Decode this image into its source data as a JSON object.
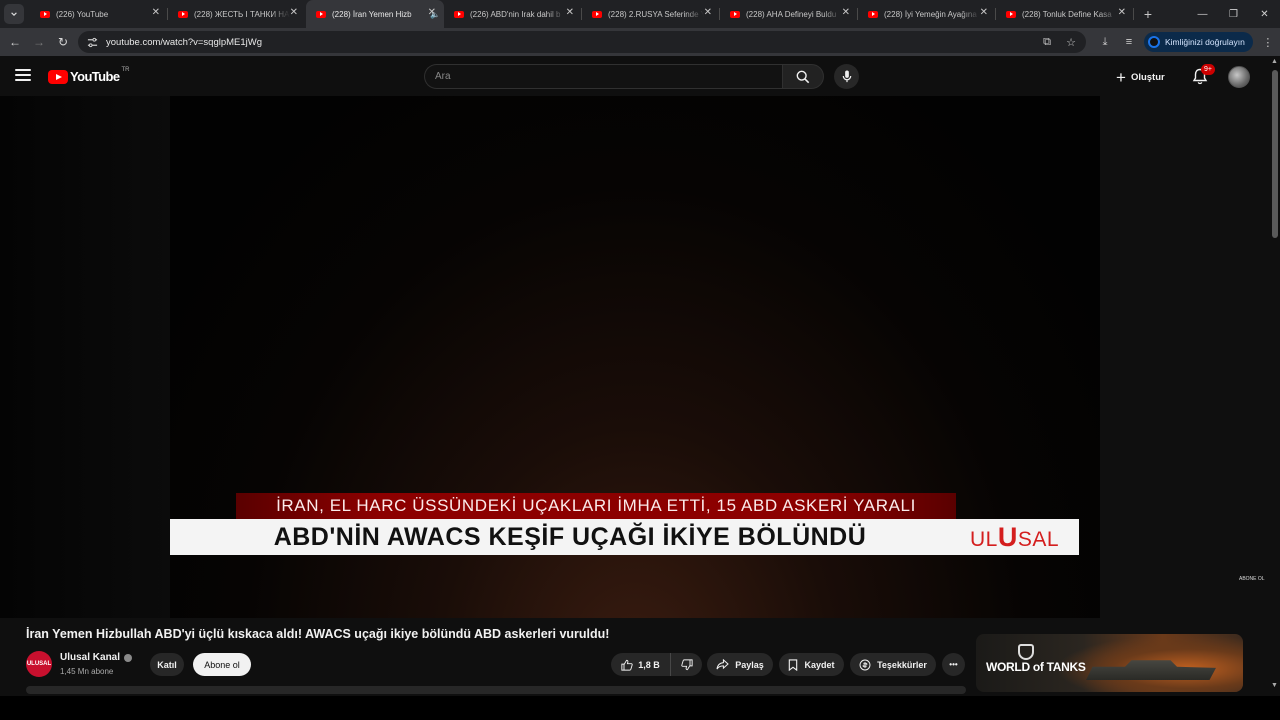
{
  "browser": {
    "tabs": [
      {
        "title": "(226) YouTube",
        "active": false
      },
      {
        "title": "(228) ЖЕСТЬ І ТАНКИ НА",
        "active": false
      },
      {
        "title": "(228) İran Yemen Hizb",
        "active": true
      },
      {
        "title": "(226) ABD'nin Irak dahil b",
        "active": false
      },
      {
        "title": "(228) 2.RUSYA Seferinde Y",
        "active": false
      },
      {
        "title": "(228) AHA Defineyi Buldu",
        "active": false
      },
      {
        "title": "(228) İyi Yemeğin Ayağına",
        "active": false
      },
      {
        "title": "(228) Tonluk Define Kasa",
        "active": false
      }
    ],
    "close_glyph": "✕",
    "newtab_glyph": "+",
    "url": "youtube.com/watch?v=sqglpME1jWg",
    "profile_chip": "Kimliğinizi doğrulayın"
  },
  "youtube": {
    "logo_text": "YouTube",
    "country_code": "TR",
    "search_placeholder": "Ara",
    "create_label": "Oluştur",
    "notifications_badge": "9+"
  },
  "video": {
    "overlay_red": "İRAN, EL HARC ÜSSÜNDEKİ UÇAKLARI İMHA ETTİ, 15 ABD ASKERİ YARALI",
    "overlay_white": "ABD'NİN AWACS KEŞİF UÇAĞI İKİYE BÖLÜNDÜ",
    "brand_left": "UL",
    "brand_mid": "U",
    "brand_right": "SAL",
    "corner_text": "ABONE OL",
    "title": "İran Yemen Hizbullah ABD'yi üçlü kıskaca aldı! AWACS uçağı ikiye bölündü ABD askerleri vuruldu!"
  },
  "channel": {
    "name": "Ulusal Kanal",
    "avatar_text": "ULUSAL",
    "subscribers": "1,45 Mn abone",
    "join_label": "Katıl",
    "subscribe_label": "Abone ol"
  },
  "actions": {
    "like_count": "1,8 B",
    "share_label": "Paylaş",
    "save_label": "Kaydet",
    "thanks_label": "Teşekkürler",
    "more_label": "•••"
  },
  "ad": {
    "brand": "WORLD of TANKS"
  }
}
